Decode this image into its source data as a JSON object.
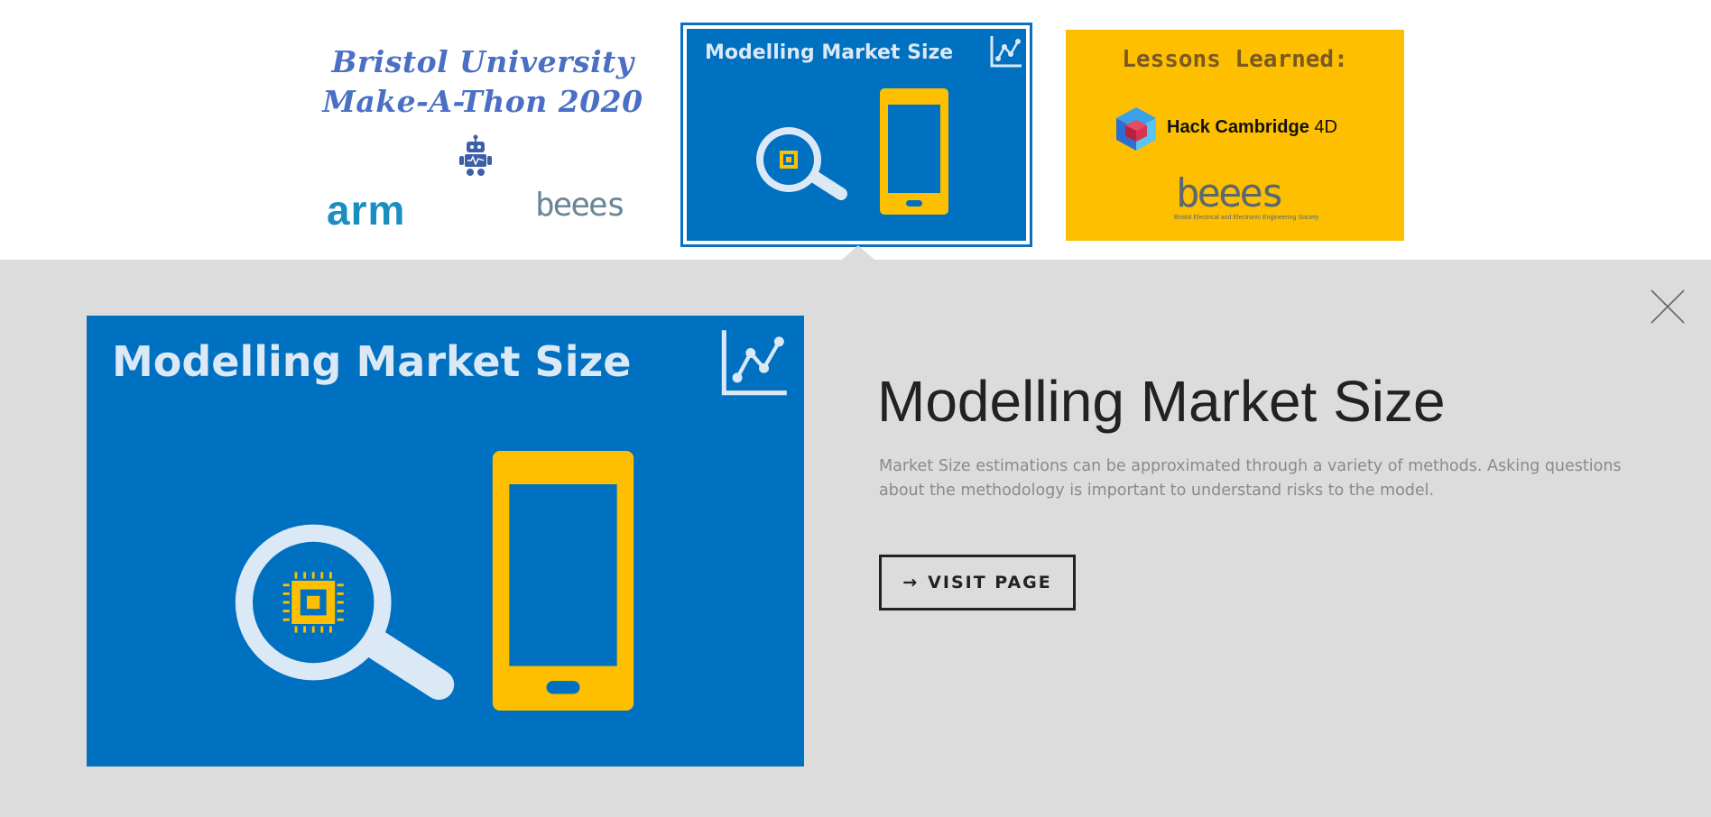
{
  "thumbnails": [
    {
      "id": "bristol",
      "title_line1": "Bristol University",
      "title_line2": "Make-A-Thon 2020",
      "logo_left": "arm",
      "logo_right": "beees",
      "icon": "robot-icon"
    },
    {
      "id": "modelling",
      "title": "Modelling Market Size",
      "icons": [
        "line-chart-icon",
        "magnifier-chip-icon",
        "smartphone-icon"
      ],
      "selected": true
    },
    {
      "id": "lessons",
      "title": "Lessons Learned:",
      "hack_text": "Hack Cambridge",
      "hack_suffix": "4D",
      "logo": "beees",
      "logo_subtitle": "Bristol Electrical and Electronic Engineering Society",
      "icon": "hack-cambridge-cube-icon"
    }
  ],
  "detail": {
    "image_title": "Modelling Market Size",
    "heading": "Modelling Market Size",
    "description": "Market Size estimations can be approximated through a variety of methods. Asking questions about the methodology is important to understand risks to the model.",
    "button_arrow": "→",
    "button_label": "VISIT PAGE",
    "close_icon": "close-icon"
  },
  "colors": {
    "panel_bg": "#dcdcdc",
    "brand_blue": "#0070c0",
    "accent_yellow": "#fdbf00",
    "bristol_text": "#4a6fc4",
    "arm_blue": "#1a8ec2"
  }
}
